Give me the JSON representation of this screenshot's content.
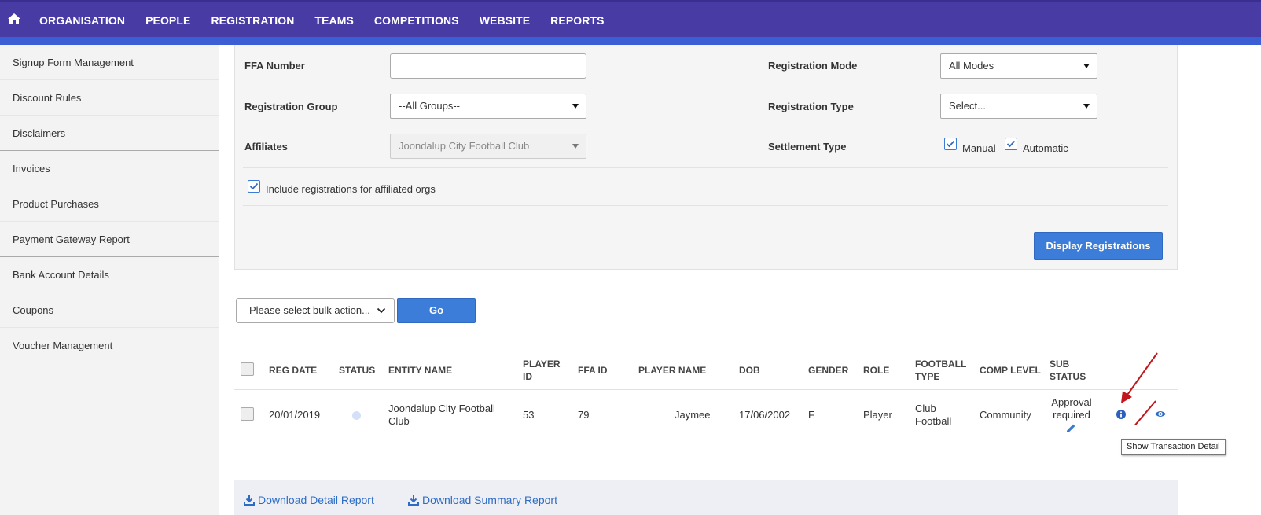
{
  "nav": {
    "items": [
      "ORGANISATION",
      "PEOPLE",
      "REGISTRATION",
      "TEAMS",
      "COMPETITIONS",
      "WEBSITE",
      "REPORTS"
    ]
  },
  "sidebar": {
    "items": [
      "Signup Form Management",
      "Discount Rules",
      "Disclaimers",
      "Invoices",
      "Product Purchases",
      "Payment Gateway Report",
      "Bank Account Details",
      "Coupons",
      "Voucher Management"
    ]
  },
  "filter": {
    "ffa_number_label": "FFA Number",
    "ffa_number_value": "",
    "registration_mode_label": "Registration Mode",
    "registration_mode_value": "All Modes",
    "registration_group_label": "Registration Group",
    "registration_group_value": "--All Groups--",
    "registration_type_label": "Registration Type",
    "registration_type_value": "Select...",
    "affiliates_label": "Affiliates",
    "affiliates_value": "Joondalup City Football Club",
    "settlement_type_label": "Settlement Type",
    "settlement_manual_label": "Manual",
    "settlement_automatic_label": "Automatic",
    "include_affiliated_label": "Include registrations for affiliated orgs",
    "display_button": "Display Registrations"
  },
  "bulk": {
    "placeholder": "Please select bulk action...",
    "go_button": "Go"
  },
  "table": {
    "headers": {
      "reg_date": "REG DATE",
      "status": "STATUS",
      "entity_name": "ENTITY NAME",
      "player_id_1": "PLAYER",
      "player_id_2": "ID",
      "ffa_id": "FFA ID",
      "player_name": "PLAYER NAME",
      "dob": "DOB",
      "gender": "GENDER",
      "role": "ROLE",
      "football_type_1": "FOOTBALL",
      "football_type_2": "TYPE",
      "comp_level": "COMP LEVEL",
      "sub_status_1": "SUB",
      "sub_status_2": "STATUS"
    },
    "rows": [
      {
        "reg_date": "20/01/2019",
        "entity_name_1": "Joondalup City Football",
        "entity_name_2": "Club",
        "player_id": "53",
        "ffa_id": "79",
        "player_name": "Jaymee",
        "dob": "17/06/2002",
        "gender": "F",
        "role": "Player",
        "football_type_1": "Club",
        "football_type_2": "Football",
        "comp_level": "Community",
        "sub_status_1": "Approval",
        "sub_status_2": "required"
      }
    ]
  },
  "tooltip": "Show Transaction Detail",
  "downloads": {
    "detail": "Download Detail Report",
    "summary": "Download Summary Report"
  },
  "colors": {
    "nav_bg": "#483ca4",
    "nav_stripe": "#3b5ed4",
    "primary_button": "#3b7dd8",
    "link": "#2d6cc4",
    "arrow": "#c0161c"
  }
}
